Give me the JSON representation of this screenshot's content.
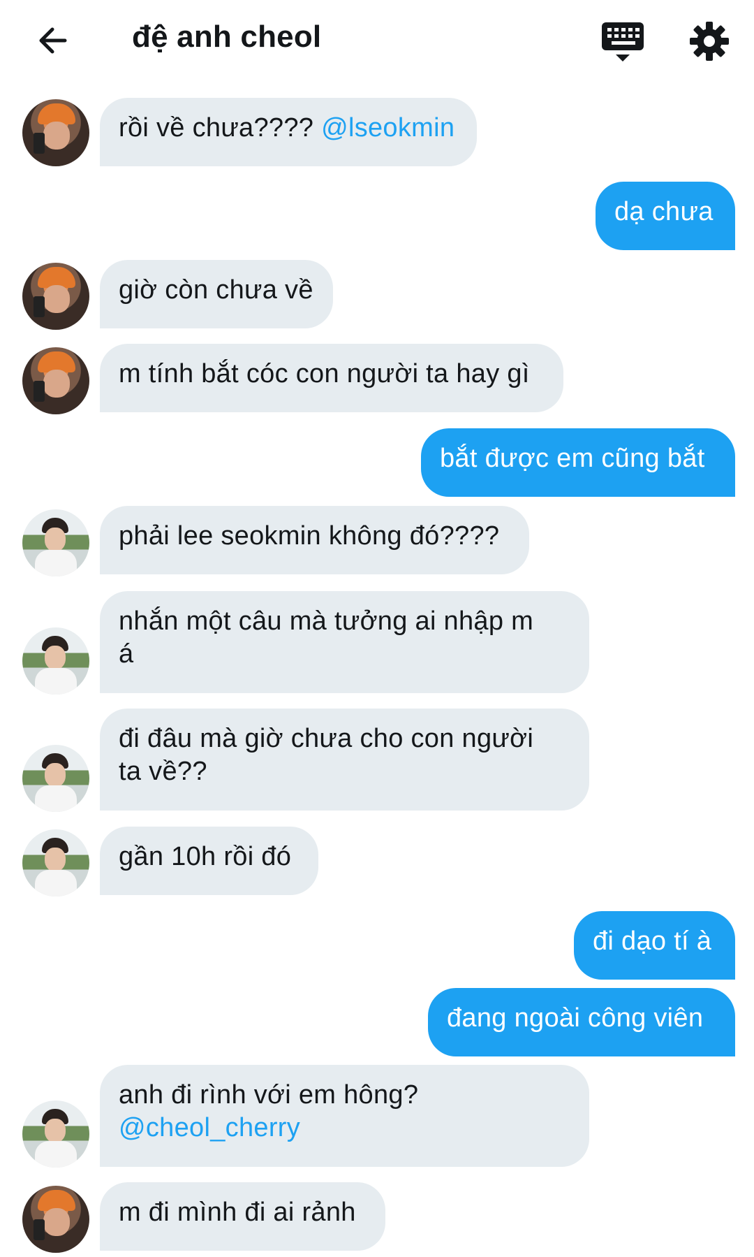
{
  "header": {
    "title": "đệ anh cheol"
  },
  "messages": [
    {
      "side": "in",
      "avatar": "orange-beanie-user",
      "text": "rồi về chưa???? ",
      "mention": "@lseokmin"
    },
    {
      "side": "out",
      "text": "dạ chưa"
    },
    {
      "side": "in",
      "avatar": "orange-beanie-user",
      "text": "giờ còn chưa về"
    },
    {
      "side": "in",
      "avatar": "orange-beanie-user",
      "text": "m tính bắt cóc con người ta hay gì"
    },
    {
      "side": "out",
      "text": "bắt được em cũng bắt"
    },
    {
      "side": "in",
      "avatar": "mountain-backdrop-user",
      "text": "phải lee seokmin không đó????"
    },
    {
      "side": "in",
      "avatar": "mountain-backdrop-user",
      "text": "nhắn một câu mà tưởng ai nhập m\ná"
    },
    {
      "side": "in",
      "avatar": "mountain-backdrop-user",
      "text": "đi đâu mà giờ chưa cho con người\nta về??"
    },
    {
      "side": "in",
      "avatar": "mountain-backdrop-user",
      "text": "gần 10h rồi đó"
    },
    {
      "side": "out",
      "text": "đi dạo tí à"
    },
    {
      "side": "out",
      "text": "đang ngoài công viên"
    },
    {
      "side": "in",
      "avatar": "mountain-backdrop-user",
      "text": "anh đi rình với em hông?\n",
      "mention": "@cheol_cherry"
    },
    {
      "side": "in",
      "avatar": "orange-beanie-user",
      "text": "m đi mình đi ai rảnh"
    }
  ],
  "colors": {
    "outgoing_bubble": "#1da1f2",
    "incoming_bubble": "#e6ecf0",
    "mention": "#1da1f2",
    "text": "#14171a"
  }
}
